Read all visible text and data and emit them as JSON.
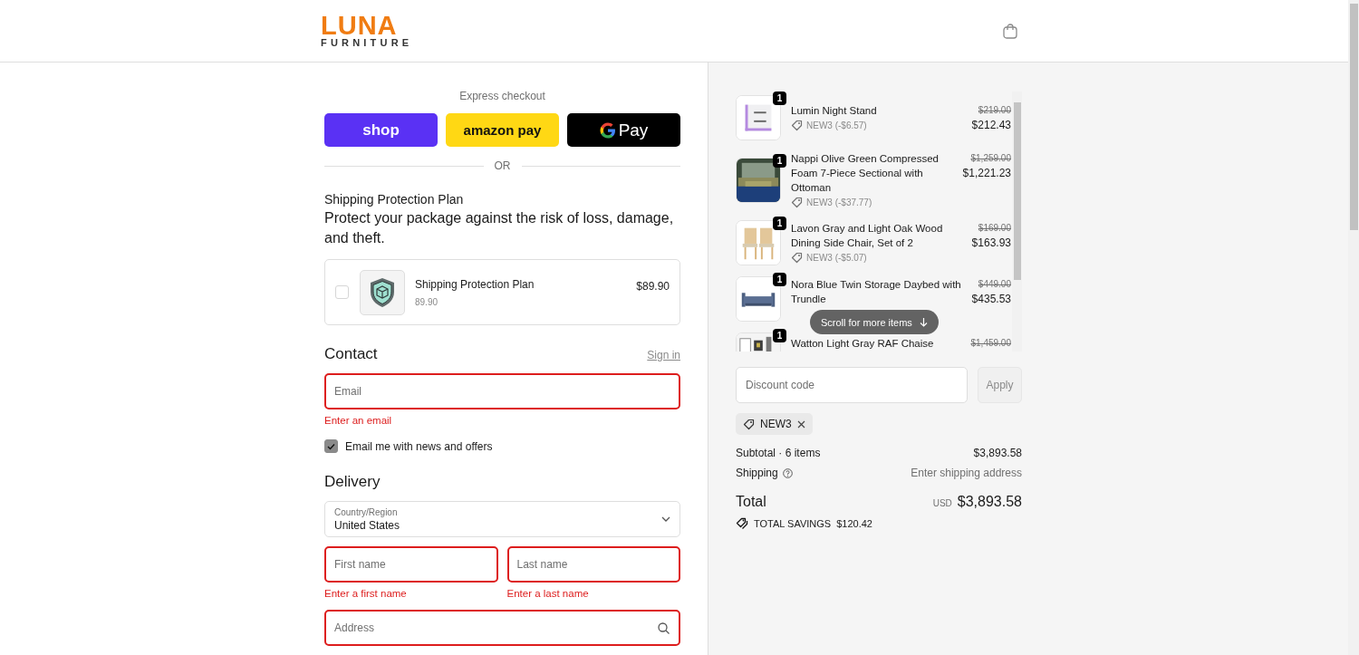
{
  "header": {
    "logo_word": "LUNA",
    "logo_sub": "FURNITURE"
  },
  "express_checkout": {
    "label": "Express checkout",
    "buttons": [
      {
        "kind": "shop",
        "label": "shop"
      },
      {
        "kind": "amazon",
        "label": "amazon pay"
      },
      {
        "kind": "gpay",
        "label": "Pay"
      }
    ],
    "divider": "OR"
  },
  "protection": {
    "title": "Shipping Protection Plan",
    "description": "Protect your package against the risk of loss, damage, and theft.",
    "option": {
      "checked": false,
      "name": "Shipping Protection Plan",
      "sub": "89.90",
      "price": "$89.90"
    }
  },
  "contact": {
    "heading": "Contact",
    "sign_in": "Sign in",
    "email": {
      "placeholder": "Email",
      "invalid": true,
      "error": "Enter an email"
    },
    "newsletter": {
      "label": "Email me with news and offers",
      "checked": true
    }
  },
  "delivery": {
    "heading": "Delivery",
    "country": {
      "label": "Country/Region",
      "value": "United States"
    },
    "name_fields": [
      {
        "placeholder": "First name",
        "invalid": true,
        "error": "Enter a first name"
      },
      {
        "placeholder": "Last name",
        "invalid": true,
        "error": "Enter a last name"
      }
    ],
    "address": {
      "placeholder": "Address",
      "invalid": true
    }
  },
  "summary": {
    "items": [
      {
        "kind": "picture",
        "qty": "1",
        "name": "Lumin Night Stand",
        "discount": "NEW3 (-$6.57)",
        "old_price": "$219.00",
        "price": "$212.43"
      },
      {
        "kind": "picture",
        "qty": "1",
        "name": "Nappi Olive Green Compressed Foam 7-Piece Sectional with Ottoman",
        "discount": "NEW3 (-$37.77)",
        "old_price": "$1,259.00",
        "price": "$1,221.23"
      },
      {
        "kind": "picture",
        "qty": "1",
        "name": "Lavon Gray and Light Oak Wood Dining Side Chair, Set of 2",
        "discount": "NEW3 (-$5.07)",
        "old_price": "$169.00",
        "price": "$163.93"
      },
      {
        "kind": "picture",
        "qty": "1",
        "name": "Nora Blue Twin Storage Daybed with Trundle",
        "old_price": "$449.00",
        "price": "$435.53"
      },
      {
        "kind": "picture",
        "qty": "1",
        "name": "Watton Light Gray RAF Chaise",
        "old_price": "$1,459.00"
      }
    ],
    "scroll_hint": "Scroll for more items",
    "discount_field": {
      "placeholder": "Discount code"
    },
    "apply": {
      "label": "Apply",
      "disabled": true
    },
    "applied_codes": [
      "NEW3"
    ],
    "subtotal": {
      "label": "Subtotal · 6 items",
      "value": "$3,893.58"
    },
    "shipping": {
      "label": "Shipping",
      "value": "Enter shipping address"
    },
    "total": {
      "label": "Total",
      "currency": "USD",
      "value": "$3,893.58"
    },
    "savings": {
      "label": "TOTAL SAVINGS",
      "value": "$120.42"
    }
  }
}
